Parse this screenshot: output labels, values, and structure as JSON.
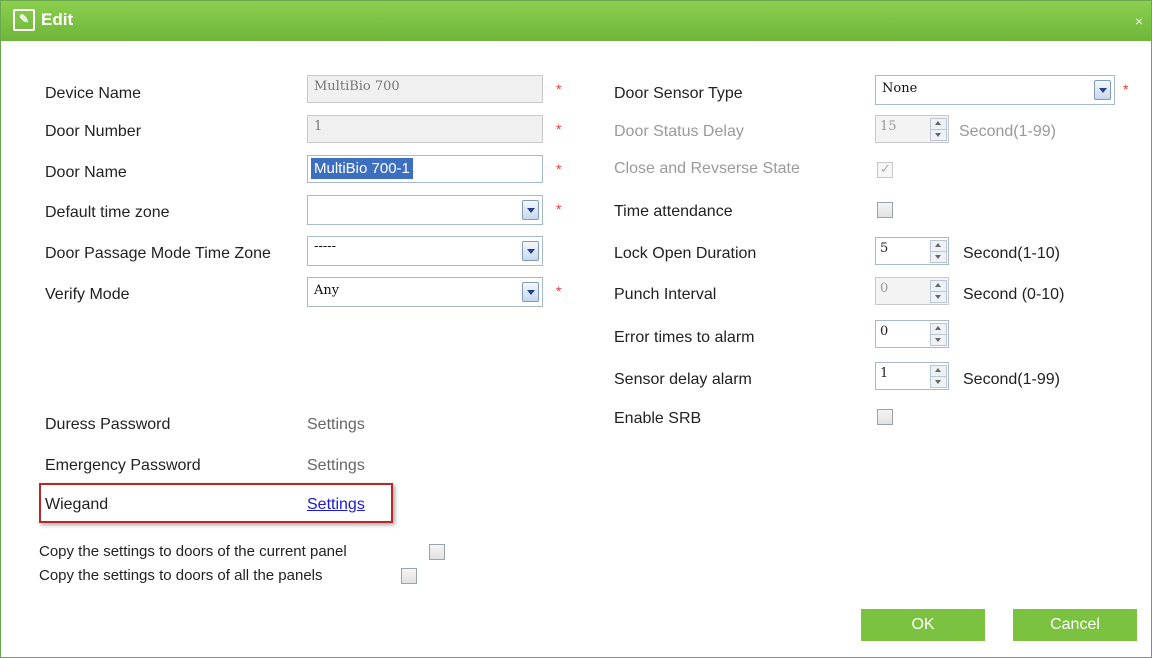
{
  "window": {
    "title": "Edit",
    "close": "×"
  },
  "left": {
    "device_name": {
      "label": "Device Name",
      "value": "MultiBio 700"
    },
    "door_number": {
      "label": "Door Number",
      "value": "1"
    },
    "door_name": {
      "label": "Door Name",
      "value": "MultiBio 700-1"
    },
    "default_time_zone": {
      "label": "Default time zone",
      "value": ""
    },
    "passage_mode": {
      "label": "Door Passage Mode Time Zone",
      "value": "-----"
    },
    "verify_mode": {
      "label": "Verify Mode",
      "value": "Any"
    },
    "duress": {
      "label": "Duress Password",
      "link": "Settings"
    },
    "emergency": {
      "label": "Emergency Password",
      "link": "Settings"
    },
    "wiegand": {
      "label": "Wiegand",
      "link": "Settings"
    },
    "copy_current": {
      "label": "Copy the settings to doors of the current panel",
      "checked": false
    },
    "copy_all": {
      "label": "Copy the settings to doors of all the panels",
      "checked": false
    }
  },
  "right": {
    "sensor_type": {
      "label": "Door Sensor Type",
      "value": "None"
    },
    "status_delay": {
      "label": "Door Status Delay",
      "value": "15",
      "unit": "Second(1-99)"
    },
    "close_reverse": {
      "label": "Close and Revserse State",
      "checked": true
    },
    "time_attendance": {
      "label": "Time attendance",
      "checked": false
    },
    "lock_open": {
      "label": "Lock Open Duration",
      "value": "5",
      "unit": "Second(1-10)"
    },
    "punch_interval": {
      "label": "Punch Interval",
      "value": "0",
      "unit": "Second (0-10)"
    },
    "error_times": {
      "label": "Error times to alarm",
      "value": "0"
    },
    "sensor_delay": {
      "label": "Sensor delay alarm",
      "value": "1",
      "unit": "Second(1-99)"
    },
    "enable_srb": {
      "label": "Enable SRB",
      "checked": false
    }
  },
  "required_mark": "*",
  "buttons": {
    "ok": "OK",
    "cancel": "Cancel"
  },
  "colors": {
    "title_bar": "#7cc241",
    "button": "#7cc241",
    "required": "#e53935",
    "highlight_border": "#b8282a",
    "link": "#1a1ad6"
  }
}
